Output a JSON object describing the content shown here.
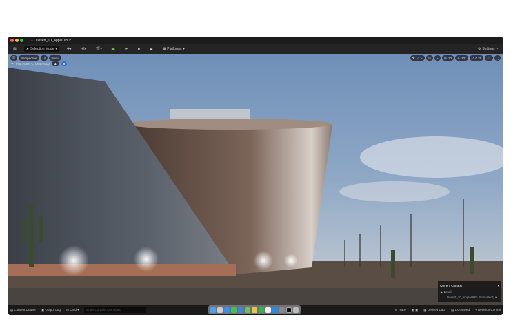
{
  "window": {
    "tab_title": "Desert_10_AppleUHD*"
  },
  "toolbar": {
    "mode": "Selection Mode",
    "platforms": "Platforms",
    "settings": "Settings"
  },
  "viewport": {
    "perspective": "Perspective",
    "lit": "Lit",
    "show": "Show",
    "pilot": "Pilot Actor: C_Desert000",
    "grid_value": "10",
    "angle_value": "10°",
    "scale_value": "0.25"
  },
  "context": {
    "header": "Current Context",
    "level_label": "Level",
    "level_name": "Desert_10_AppleUHD (Persistent)"
  },
  "statusbar": {
    "content_drawer": "Content Drawer",
    "output_log": "Output Log",
    "cmd": "Cmd",
    "cmd_placeholder": "Enter Console Command",
    "trace": "Trace",
    "derived_data": "Derived Data",
    "unsaved": "1 Unsaved",
    "revision_control": "Revision Control"
  },
  "colors": {
    "accent": "#2a6fd1",
    "play": "#5bc236"
  }
}
